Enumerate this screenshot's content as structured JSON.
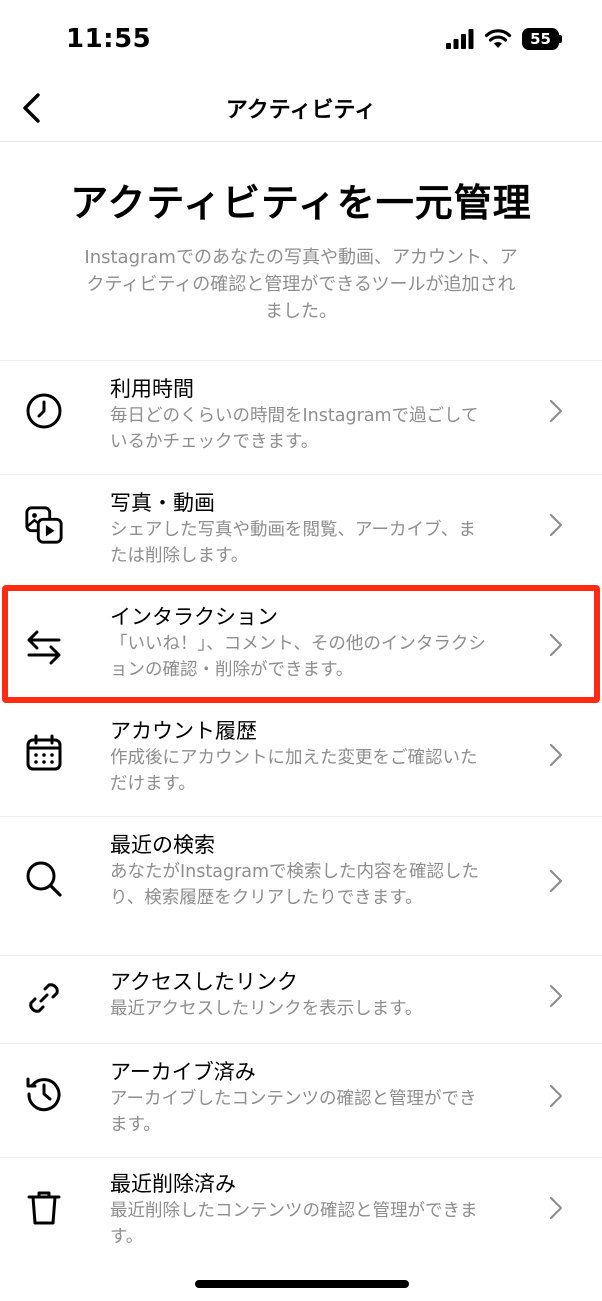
{
  "status": {
    "time": "11:55",
    "battery": "55"
  },
  "nav": {
    "title": "アクティビティ"
  },
  "hero": {
    "title": "アクティビティを一元管理",
    "description": "Instagramでのあなたの写真や動画、アカウント、アクティビティの確認と管理ができるツールが追加されました。"
  },
  "items": [
    {
      "title": "利用時間",
      "sub": "毎日どのくらいの時間をInstagramで過ごしているかチェックできます。",
      "icon": "clock-icon"
    },
    {
      "title": "写真・動画",
      "sub": "シェアした写真や動画を閲覧、アーカイブ、または削除します。",
      "icon": "photos-videos-icon"
    },
    {
      "title": "インタラクション",
      "sub": "「いいね！」、コメント、その他のインタラクションの確認・削除ができます。",
      "icon": "arrows-exchange-icon"
    },
    {
      "title": "アカウント履歴",
      "sub": "作成後にアカウントに加えた変更をご確認いただけます。",
      "icon": "calendar-icon"
    },
    {
      "title": "最近の検索",
      "sub": "あなたがInstagramで検索した内容を確認したり、検索履歴をクリアしたりできます。",
      "icon": "search-icon"
    },
    {
      "title": "アクセスしたリンク",
      "sub": "最近アクセスしたリンクを表示します。",
      "icon": "link-icon"
    },
    {
      "title": "アーカイブ済み",
      "sub": "アーカイブしたコンテンツの確認と管理ができます。",
      "icon": "archive-history-icon"
    },
    {
      "title": "最近削除済み",
      "sub": "最近削除したコンテンツの確認と管理ができます。",
      "icon": "trash-icon"
    }
  ],
  "colors": {
    "highlight": "#ff2a12",
    "subtext": "#8e8e8e"
  }
}
